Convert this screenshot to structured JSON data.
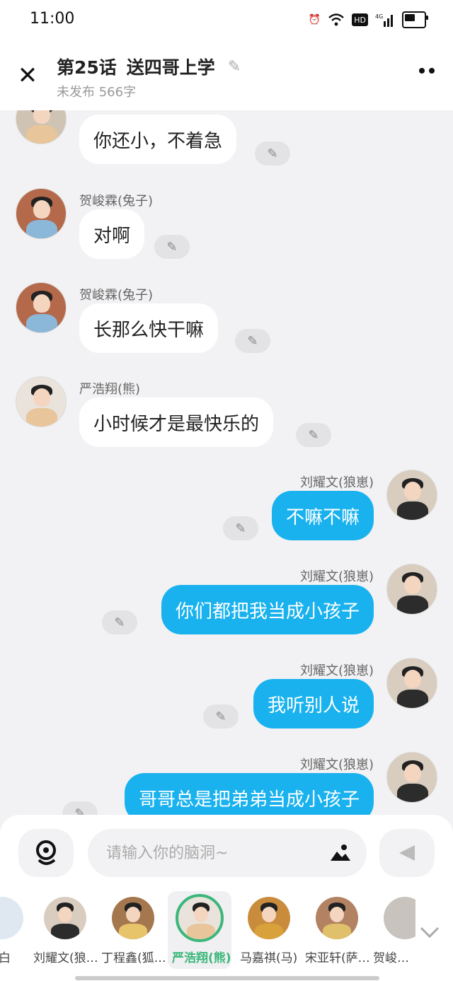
{
  "status": {
    "time": "11:00",
    "hd": "HD",
    "network": "4G"
  },
  "header": {
    "episode": "第25话",
    "title": "送四哥上学",
    "subtitle": "未发布 566字"
  },
  "messages": [
    {
      "side": "left",
      "name": "",
      "text": "你还小，不着急",
      "avatar_colors": [
        "#cfc3b3",
        "#e8c59a"
      ]
    },
    {
      "side": "left",
      "name": "贺峻霖(兔子)",
      "text": "对啊",
      "avatar_colors": [
        "#b5694b",
        "#8bb7d9"
      ]
    },
    {
      "side": "left",
      "name": "贺峻霖(兔子)",
      "text": "长那么快干嘛",
      "avatar_colors": [
        "#b5694b",
        "#8bb7d9"
      ]
    },
    {
      "side": "left",
      "name": "严浩翔(熊)",
      "text": "小时候才是最快乐的",
      "avatar_colors": [
        "#e9e3dc",
        "#e8c59a"
      ]
    },
    {
      "side": "right",
      "name": "刘耀文(狼崽)",
      "text": "不嘛不嘛",
      "avatar_colors": [
        "#d8cdbf",
        "#2c2c2c"
      ]
    },
    {
      "side": "right",
      "name": "刘耀文(狼崽)",
      "text": "你们都把我当成小孩子",
      "avatar_colors": [
        "#d8cdbf",
        "#2c2c2c"
      ]
    },
    {
      "side": "right",
      "name": "刘耀文(狼崽)",
      "text": "我听别人说",
      "avatar_colors": [
        "#d8cdbf",
        "#2c2c2c"
      ]
    },
    {
      "side": "right",
      "name": "刘耀文(狼崽)",
      "text": "哥哥总是把弟弟当成小孩子",
      "avatar_colors": [
        "#d8cdbf",
        "#2c2c2c"
      ]
    }
  ],
  "composer": {
    "placeholder": "请输入你的脑洞~"
  },
  "characters": [
    {
      "label": "白",
      "selected": false,
      "avatar_colors": [
        "#dfe8f0",
        "#9ec9e6"
      ]
    },
    {
      "label": "刘耀文(狼…",
      "selected": false,
      "avatar_colors": [
        "#d8cdbf",
        "#2c2c2c"
      ]
    },
    {
      "label": "丁程鑫(狐…",
      "selected": false,
      "avatar_colors": [
        "#a5774f",
        "#e7c36a"
      ]
    },
    {
      "label": "严浩翔(熊)",
      "selected": true,
      "avatar_colors": [
        "#e9e3dc",
        "#e8c59a"
      ]
    },
    {
      "label": "马嘉祺(马)",
      "selected": false,
      "avatar_colors": [
        "#c98c3c",
        "#d8a13c"
      ]
    },
    {
      "label": "宋亚轩(萨…",
      "selected": false,
      "avatar_colors": [
        "#b28262",
        "#e0c06a"
      ]
    },
    {
      "label": "贺峻…",
      "selected": false,
      "avatar_colors": [
        "#c9c3bd",
        "#8bb7d9"
      ]
    }
  ]
}
